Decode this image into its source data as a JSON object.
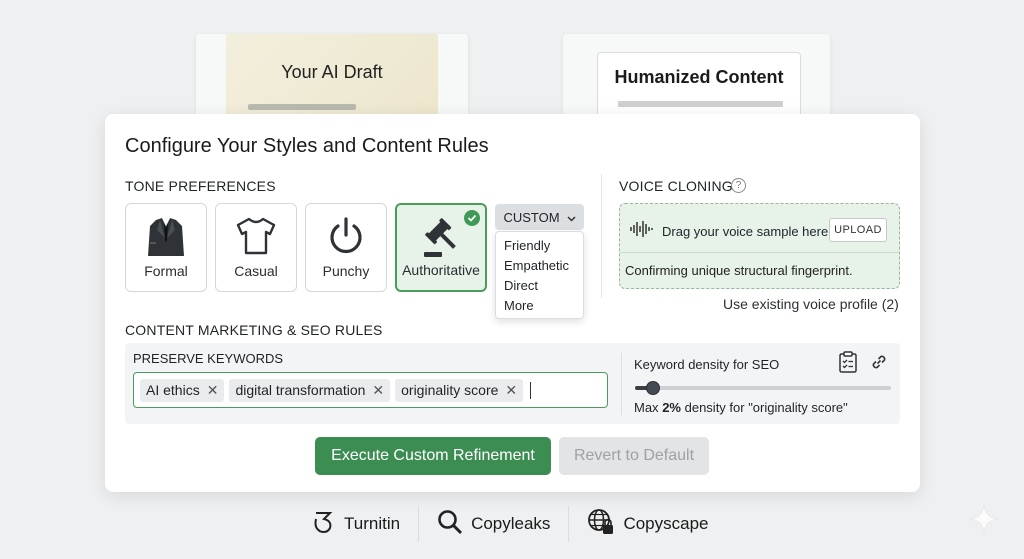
{
  "cards": {
    "draft_title": "Your AI Draft",
    "human_title": "Humanized Content"
  },
  "panel": {
    "title": "Configure Your Styles and Content Rules",
    "tone": {
      "label": "TONE PREFERENCES",
      "options": [
        {
          "label": "Formal",
          "icon": "suit-icon",
          "selected": false
        },
        {
          "label": "Casual",
          "icon": "tshirt-icon",
          "selected": false
        },
        {
          "label": "Punchy",
          "icon": "power-icon",
          "selected": false
        },
        {
          "label": "Authoritative",
          "icon": "gavel-icon",
          "selected": true
        }
      ],
      "custom_label": "CUSTOM",
      "custom_options": [
        "Friendly",
        "Empathetic",
        "Direct",
        "More"
      ]
    },
    "voice": {
      "label": "VOICE CLONING",
      "help_glyph": "?",
      "drop_text": "Drag your voice sample here",
      "upload_label": "UPLOAD",
      "status": "Confirming unique structural fingerprint.",
      "existing_link": "Use existing voice profile (2)"
    },
    "seo": {
      "label": "CONTENT MARKETING & SEO RULES",
      "keywords_label": "PRESERVE KEYWORDS",
      "keywords": [
        "AI ethics",
        "digital transformation",
        "originality score"
      ],
      "remove_glyph": "✕",
      "density_label": "Keyword density for SEO",
      "density_value": 0.07,
      "density_note_prefix": "Max",
      "density_note_value": "2%",
      "density_note_suffix": "density for \"originality score\""
    },
    "actions": {
      "execute_label": "Execute Custom Refinement",
      "revert_label": "Revert to Default"
    }
  },
  "brands": [
    "Turnitin",
    "Copyleaks",
    "Copyscape"
  ],
  "colors": {
    "accent_green": "#3c8d52",
    "selected_bg": "#e7f3e8",
    "page_bg": "#eef0f1"
  }
}
